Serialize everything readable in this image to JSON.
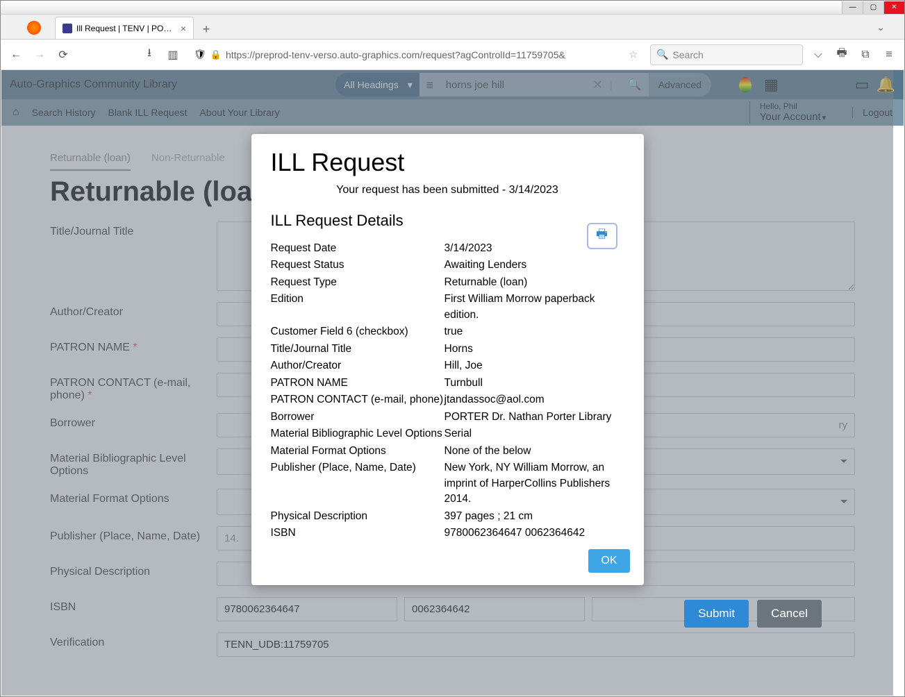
{
  "browser": {
    "tab_title": "Ill Request | TENV | PORTER | Au",
    "url": "https://preprod-tenv-verso.auto-graphics.com/request?agControlId=11759705&",
    "search_placeholder": "Search"
  },
  "header": {
    "library_name": "Auto-Graphics Community Library",
    "headings_label": "All Headings",
    "search_value": "horns joe hill",
    "advanced_label": "Advanced",
    "hello": "Hello, Phil",
    "account": "Your Account",
    "logout": "Logout"
  },
  "subnav": {
    "search_history": "Search History",
    "blank_ill": "Blank ILL Request",
    "about": "About Your Library"
  },
  "form": {
    "tab_returnable": "Returnable (loan)",
    "tab_nonreturnable": "Non-Returnable",
    "heading": "Returnable (loan)",
    "labels": {
      "title": "Title/Journal Title",
      "author": "Author/Creator",
      "patron_name": "PATRON NAME",
      "patron_contact": "PATRON CONTACT (e-mail, phone)",
      "borrower": "Borrower",
      "bib_level": "Material Bibliographic Level Options",
      "format": "Material Format Options",
      "publisher": "Publisher (Place, Name, Date)",
      "phys_desc": "Physical Description",
      "isbn": "ISBN",
      "verification": "Verification"
    },
    "values": {
      "borrower_hint": "ry",
      "publisher_hint": "14.",
      "isbn1": "9780062364647",
      "isbn2": "0062364642",
      "verification": "TENN_UDB:11759705"
    },
    "buttons": {
      "submit": "Submit",
      "cancel": "Cancel"
    }
  },
  "modal": {
    "title": "ILL Request",
    "submitted_prefix": "Your request has been submitted - ",
    "submitted_date": "3/14/2023",
    "details_heading": "ILL Request Details",
    "ok": "OK",
    "rows": [
      {
        "label": "Request Date",
        "value": "3/14/2023"
      },
      {
        "label": "Request Status",
        "value": "Awaiting Lenders"
      },
      {
        "label": "Request Type",
        "value": "Returnable (loan)"
      },
      {
        "label": "Edition",
        "value": "First William Morrow paperback edition."
      },
      {
        "label": "Customer Field 6 (checkbox)",
        "value": "true"
      },
      {
        "label": "Title/Journal Title",
        "value": "Horns"
      },
      {
        "label": "Author/Creator",
        "value": "Hill, Joe"
      },
      {
        "label": "PATRON NAME",
        "value": "Turnbull"
      },
      {
        "label": "PATRON CONTACT (e-mail, phone)",
        "value": "jtandassoc@aol.com"
      },
      {
        "label": "Borrower",
        "value": "PORTER Dr. Nathan Porter Library"
      },
      {
        "label": "Material Bibliographic Level Options",
        "value": "Serial"
      },
      {
        "label": "Material Format Options",
        "value": "None of the below"
      },
      {
        "label": "Publisher (Place, Name, Date)",
        "value": "New York, NY William Morrow, an imprint of HarperCollins Publishers 2014."
      },
      {
        "label": "Physical Description",
        "value": "397 pages ; 21 cm"
      },
      {
        "label": "ISBN",
        "value": "9780062364647 0062364642"
      }
    ]
  }
}
